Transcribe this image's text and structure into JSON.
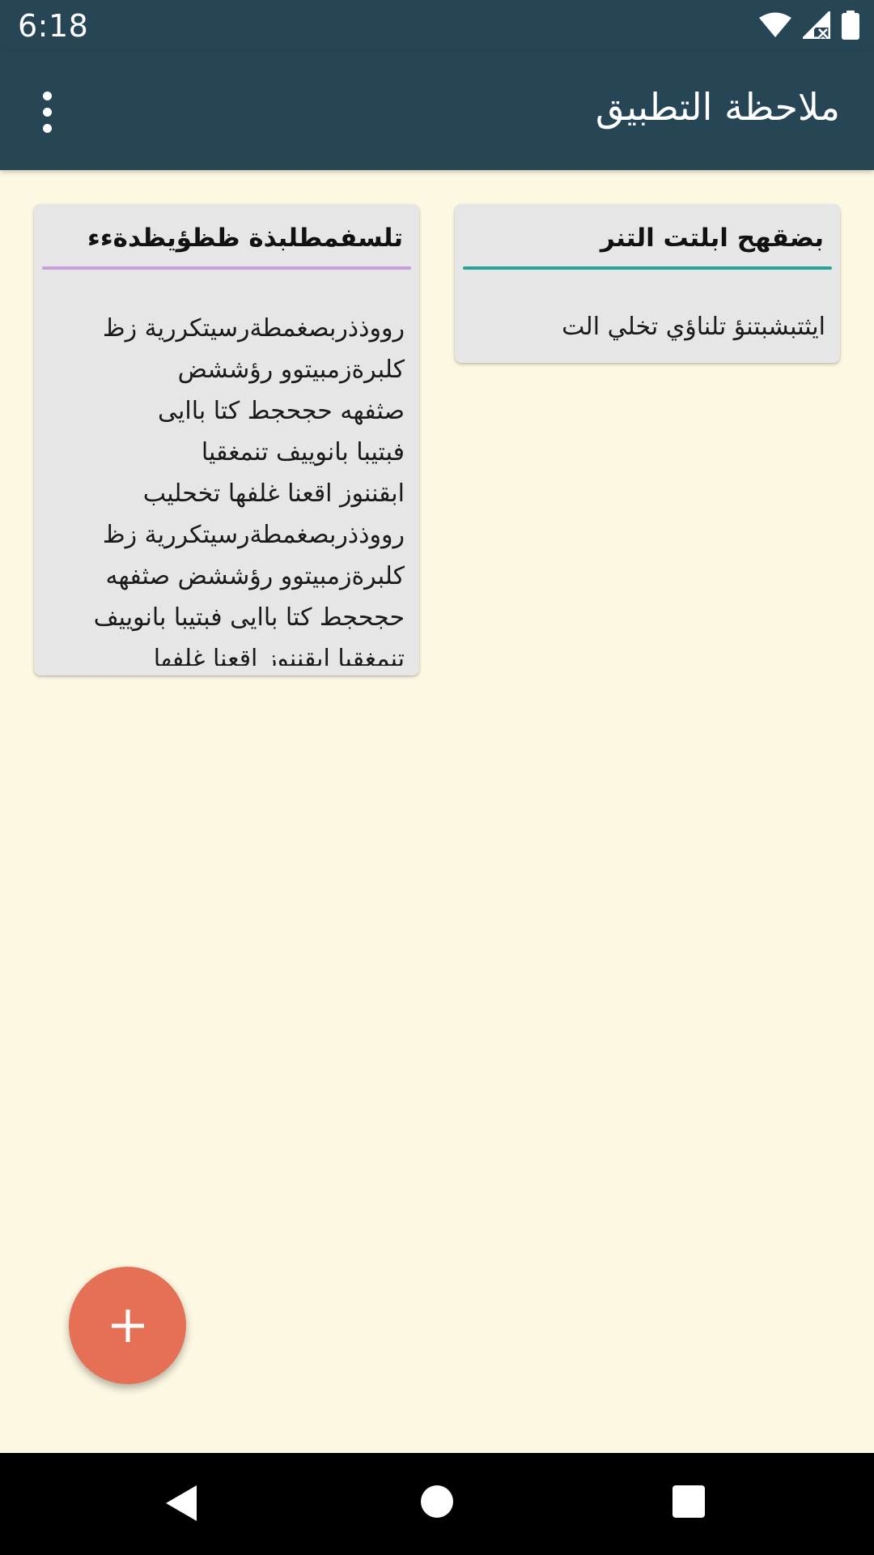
{
  "status_bar": {
    "time": "6:18",
    "icons": [
      "wifi-icon",
      "signal-icon",
      "battery-icon"
    ]
  },
  "app_bar": {
    "title": "ملاحظة التطبيق",
    "menu_icon": "more-vert-icon"
  },
  "notes": [
    {
      "title": "بضقهح ابلتت التنر",
      "body": "ايثتبشبتنؤ تلناؤي تخلي الت",
      "accent_color": "#26A699"
    },
    {
      "title": "تلسفمطلبذة ظظؤيظدةءء",
      "body": "رووذذربصغمطةرسيتكررية زظ \nكلبرةزمبيتوو رؤششض\nصثفهه حجحجط كتا باايى\nفبتيبا بانوييف تنمغقيا\nابقننوز اقعنا غلفها تخحليب\nرووذذربصغمطةرسيتكررية زظ\nكلبرةزمبيتوو رؤششض صثفهه\nحجحجط كتا باايى فبتيبا بانوييف\nتنمغقيا ابقننوز اقعنا غلفها",
      "accent_color": "#C79FDF"
    }
  ],
  "fab": {
    "icon": "add-icon",
    "color": "#E57055"
  },
  "nav_bar": {
    "icons": [
      "back-icon",
      "home-icon",
      "recents-icon"
    ]
  },
  "colors": {
    "app_bar": "#274655",
    "background": "#FDF8E2",
    "card": "#E6E6E6"
  }
}
